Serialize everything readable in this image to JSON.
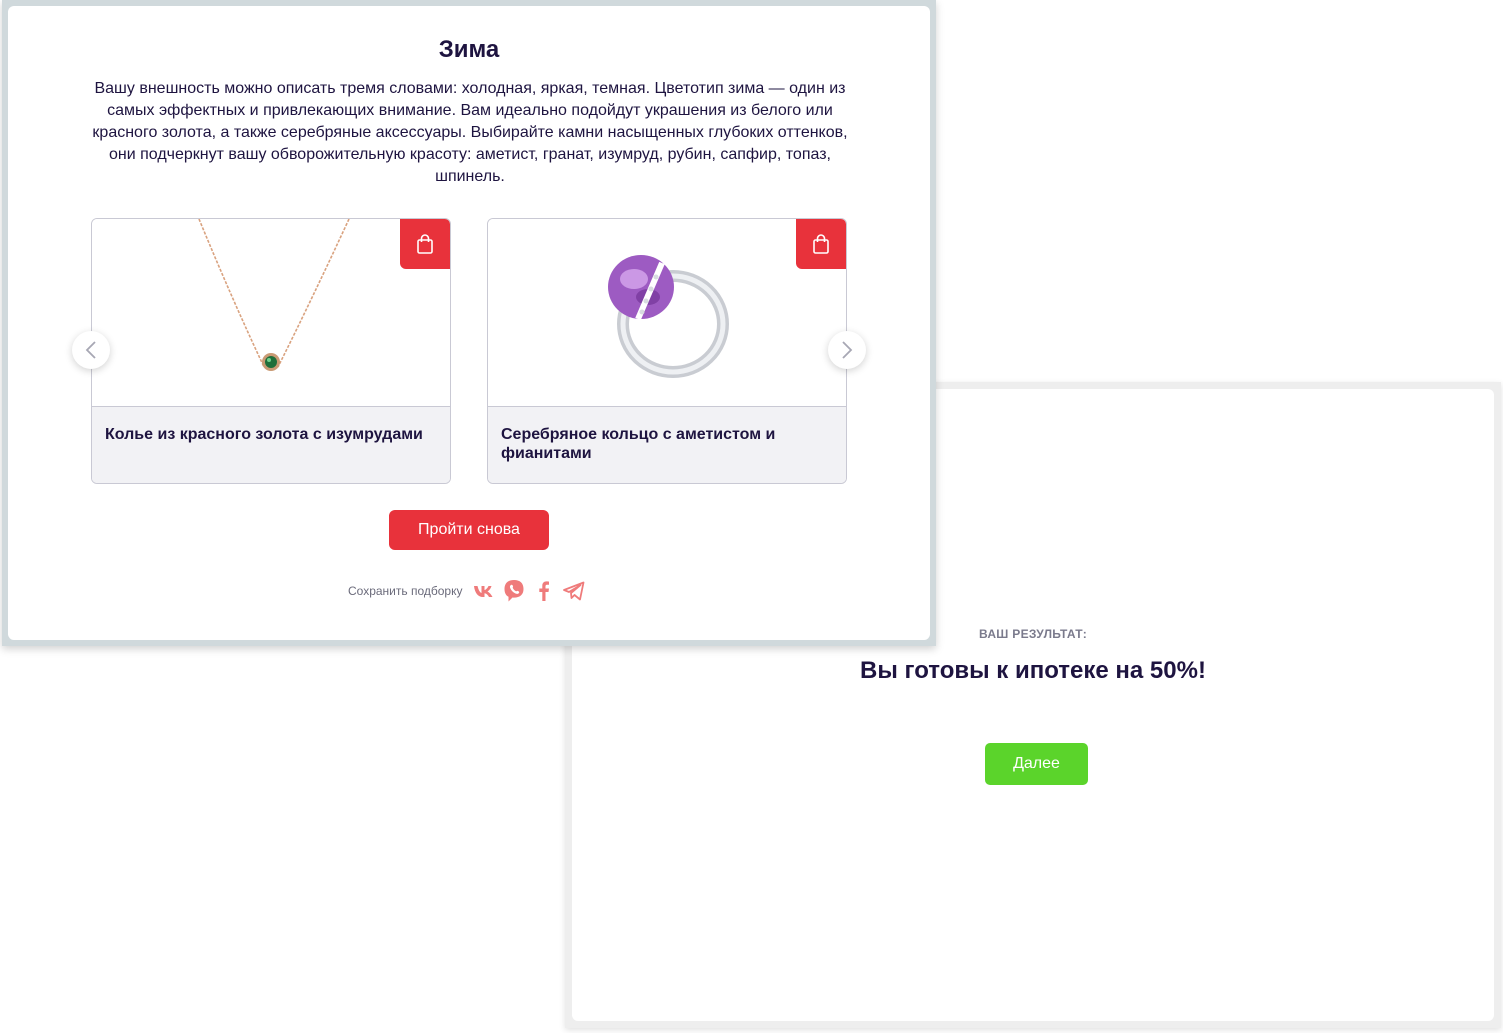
{
  "main": {
    "title": "Зима",
    "description": "Вашу внешность можно описать тремя словами: холодная, яркая, темная. Цветотип зима — один из самых эффектных и привлекающих внимание. Вам идеально подойдут украшения из белого или красного золота, а также серебряные аксессуары. Выбирайте камни насыщенных глубоких оттенков, они подчеркнут вашу обворожительную красоту: аметист, гранат, изумруд, рубин, сапфир, топаз, шпинель.",
    "products": [
      {
        "name": "Колье из красного золота с изумрудами",
        "image_icon": "necklace-image"
      },
      {
        "name": "Серебряное кольцо с аметистом и фианитами",
        "image_icon": "ring-image"
      }
    ],
    "retry_label": "Пройти снова",
    "share_label": "Сохранить подборку",
    "share_icons": [
      "vk-icon",
      "viber-icon",
      "facebook-icon",
      "telegram-icon"
    ]
  },
  "result": {
    "label": "ВАШ РЕЗУЛЬТАТ:",
    "title": "Вы готовы к ипотеке на 50%!",
    "next_label": "Далее"
  },
  "colors": {
    "accent_red": "#e8323b",
    "accent_green": "#5bd42b",
    "text_dark": "#1e1440",
    "share_icon": "#ef7b7b"
  }
}
